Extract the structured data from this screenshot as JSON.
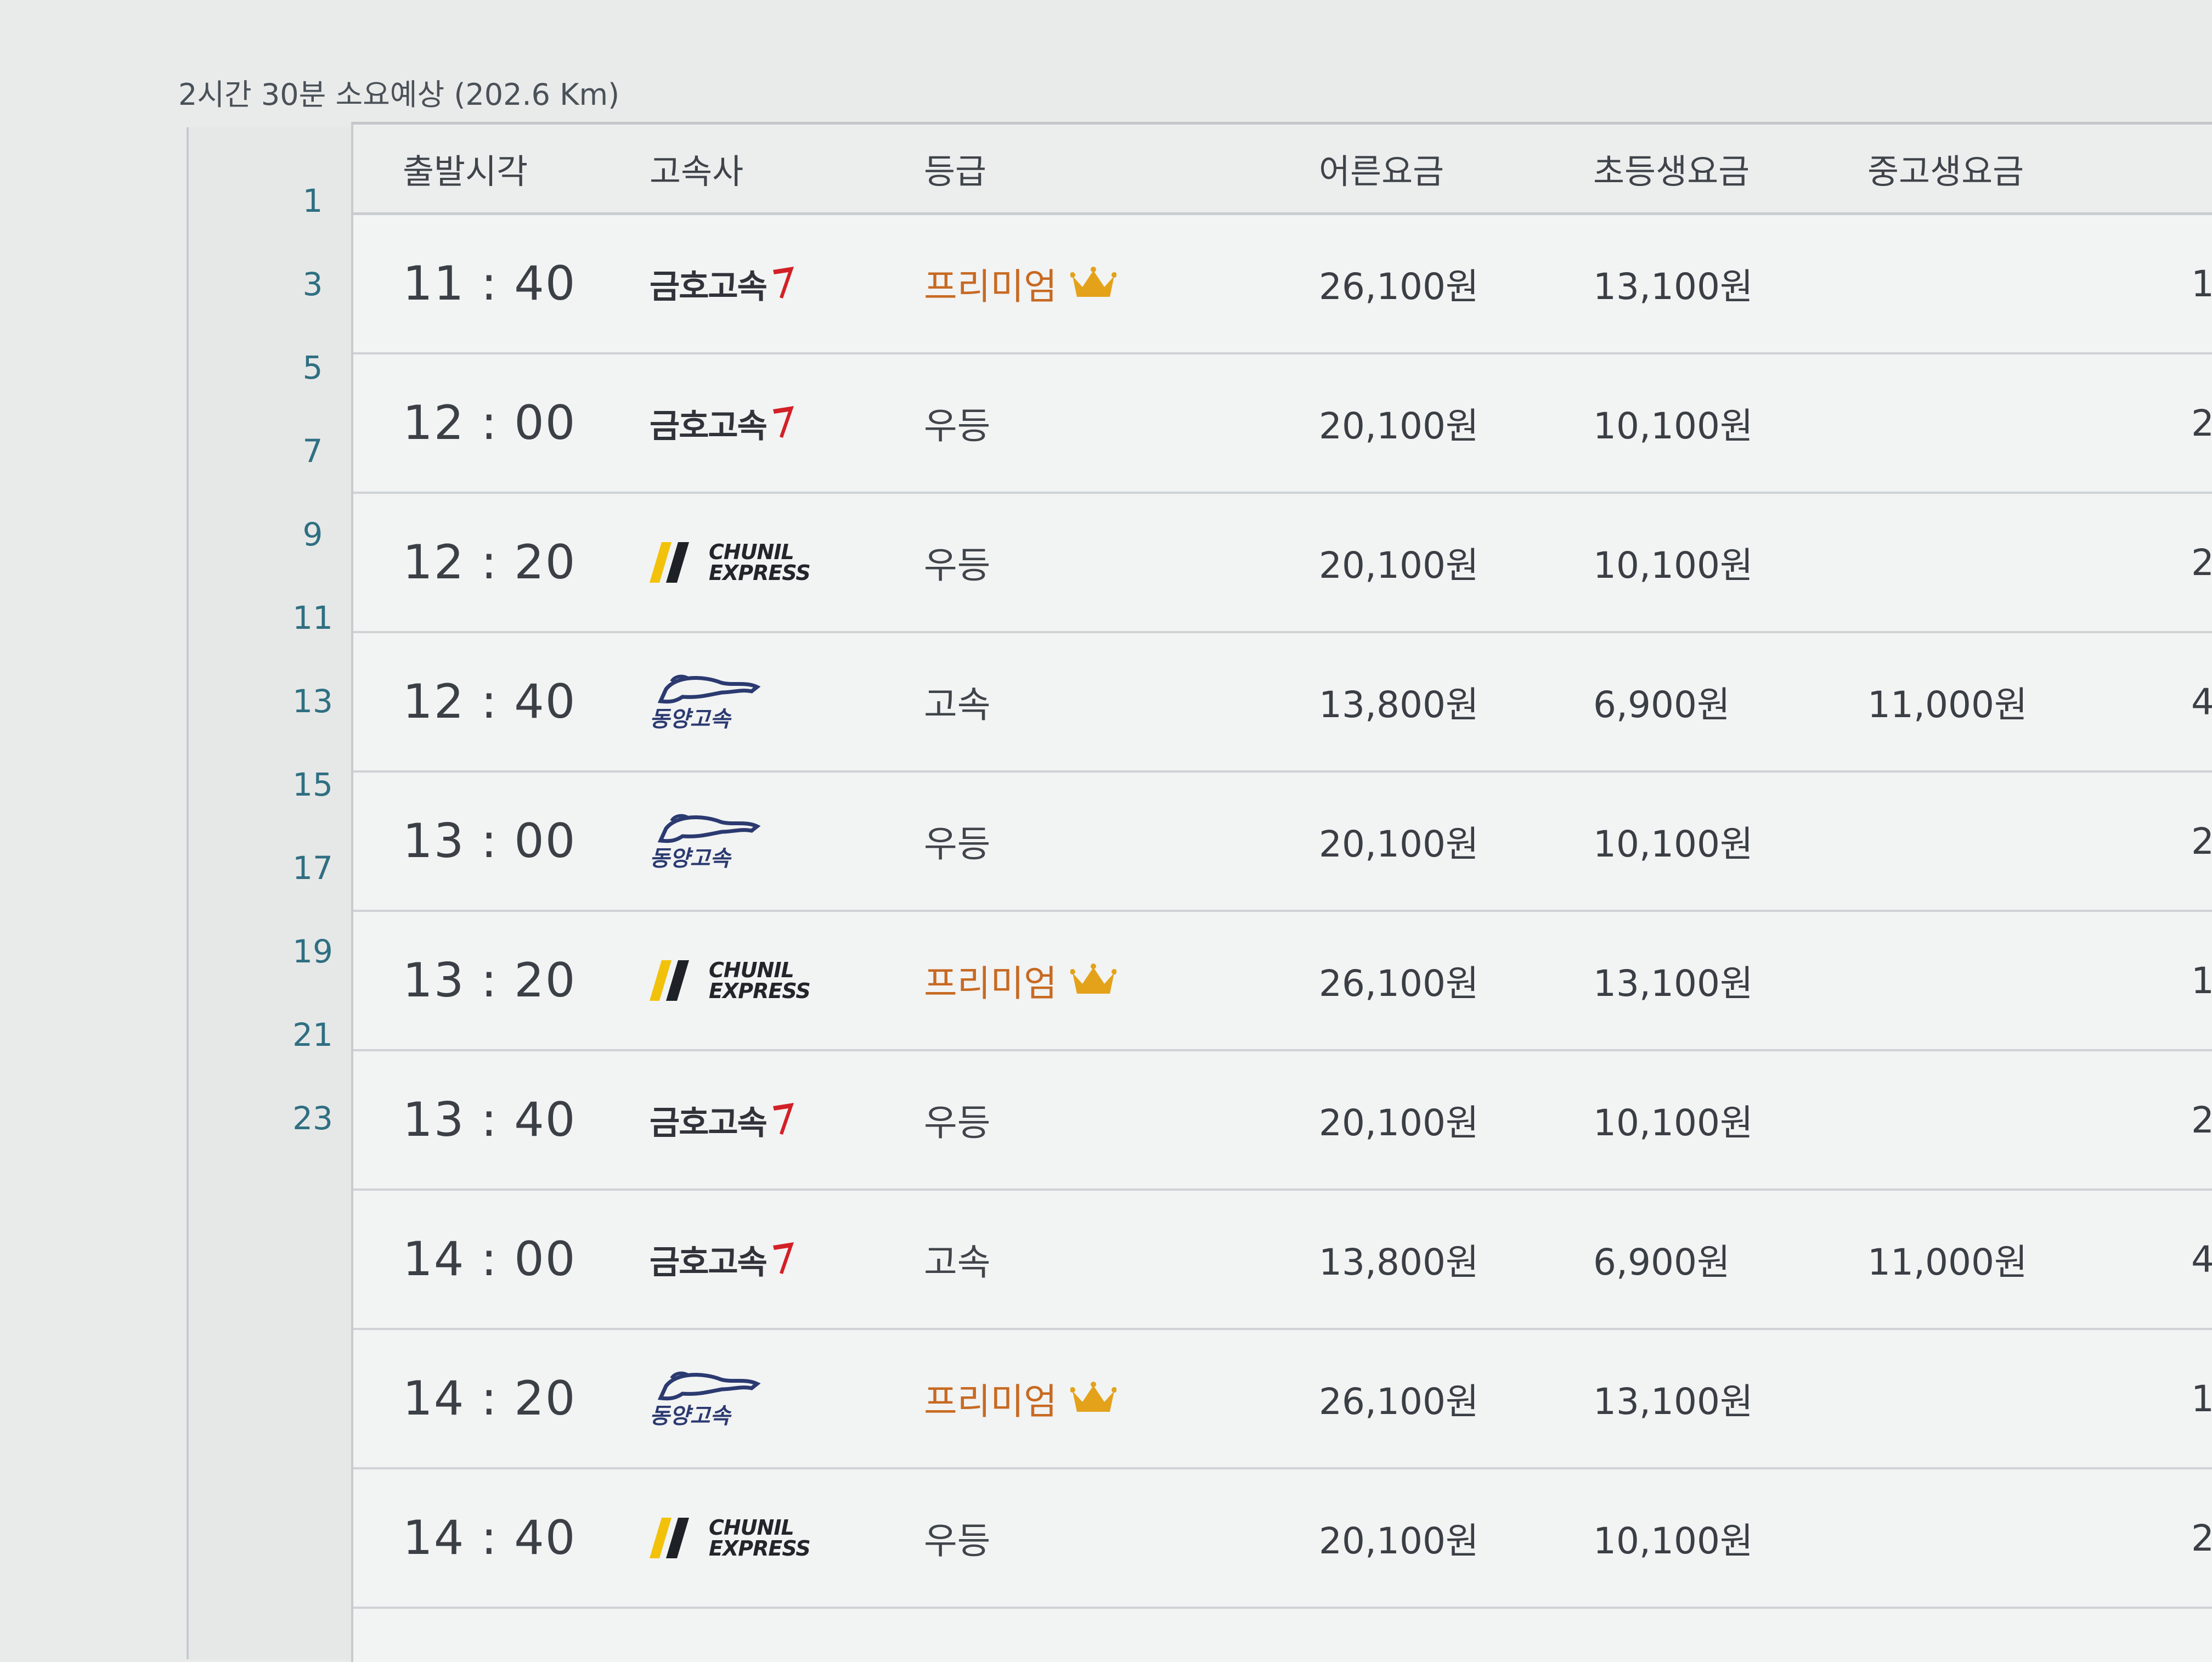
{
  "summary": {
    "duration_text": "2시간 30분 소요예상 (202.6 Km)"
  },
  "line_numbers": [
    "1",
    "3",
    "5",
    "7",
    "9",
    "11",
    "13",
    "15",
    "17",
    "19",
    "21",
    "23"
  ],
  "table": {
    "headers": {
      "departure": "출발시각",
      "company": "고속사",
      "grade": "등급",
      "adult_fare": "어른요금",
      "child_fare": "초등생요금",
      "teen_fare": "중고생요금"
    },
    "rows": [
      {
        "time": "11 : 40",
        "company": "kumho",
        "company_name": "금호고속",
        "grade": "프리미엄",
        "premium": true,
        "adult": "26,100원",
        "child": "13,100원",
        "teen": "",
        "rem": "1"
      },
      {
        "time": "12 : 00",
        "company": "kumho",
        "company_name": "금호고속",
        "grade": "우등",
        "premium": false,
        "adult": "20,100원",
        "child": "10,100원",
        "teen": "",
        "rem": "2"
      },
      {
        "time": "12 : 20",
        "company": "chunil",
        "company_name": "CHUNIL EXPRESS",
        "grade": "우등",
        "premium": false,
        "adult": "20,100원",
        "child": "10,100원",
        "teen": "",
        "rem": "2"
      },
      {
        "time": "12 : 40",
        "company": "dongyang",
        "company_name": "동양고속",
        "grade": "고속",
        "premium": false,
        "adult": "13,800원",
        "child": "6,900원",
        "teen": "11,000원",
        "rem": "4"
      },
      {
        "time": "13 : 00",
        "company": "dongyang",
        "company_name": "동양고속",
        "grade": "우등",
        "premium": false,
        "adult": "20,100원",
        "child": "10,100원",
        "teen": "",
        "rem": "2"
      },
      {
        "time": "13 : 20",
        "company": "chunil",
        "company_name": "CHUNIL EXPRESS",
        "grade": "프리미엄",
        "premium": true,
        "adult": "26,100원",
        "child": "13,100원",
        "teen": "",
        "rem": "1"
      },
      {
        "time": "13 : 40",
        "company": "kumho",
        "company_name": "금호고속",
        "grade": "우등",
        "premium": false,
        "adult": "20,100원",
        "child": "10,100원",
        "teen": "",
        "rem": "2"
      },
      {
        "time": "14 : 00",
        "company": "kumho",
        "company_name": "금호고속",
        "grade": "고속",
        "premium": false,
        "adult": "13,800원",
        "child": "6,900원",
        "teen": "11,000원",
        "rem": "4"
      },
      {
        "time": "14 : 20",
        "company": "dongyang",
        "company_name": "동양고속",
        "grade": "프리미엄",
        "premium": true,
        "adult": "26,100원",
        "child": "13,100원",
        "teen": "",
        "rem": "1"
      },
      {
        "time": "14 : 40",
        "company": "chunil",
        "company_name": "CHUNIL EXPRESS",
        "grade": "우등",
        "premium": false,
        "adult": "20,100원",
        "child": "10,100원",
        "teen": "",
        "rem": "2"
      }
    ]
  },
  "colors": {
    "premium": "#c76a22",
    "crown": "#e3a21a",
    "kumho_accent": "#d32027",
    "chunil_yellow": "#f2c20a",
    "dongyang_blue": "#2b3a70"
  }
}
